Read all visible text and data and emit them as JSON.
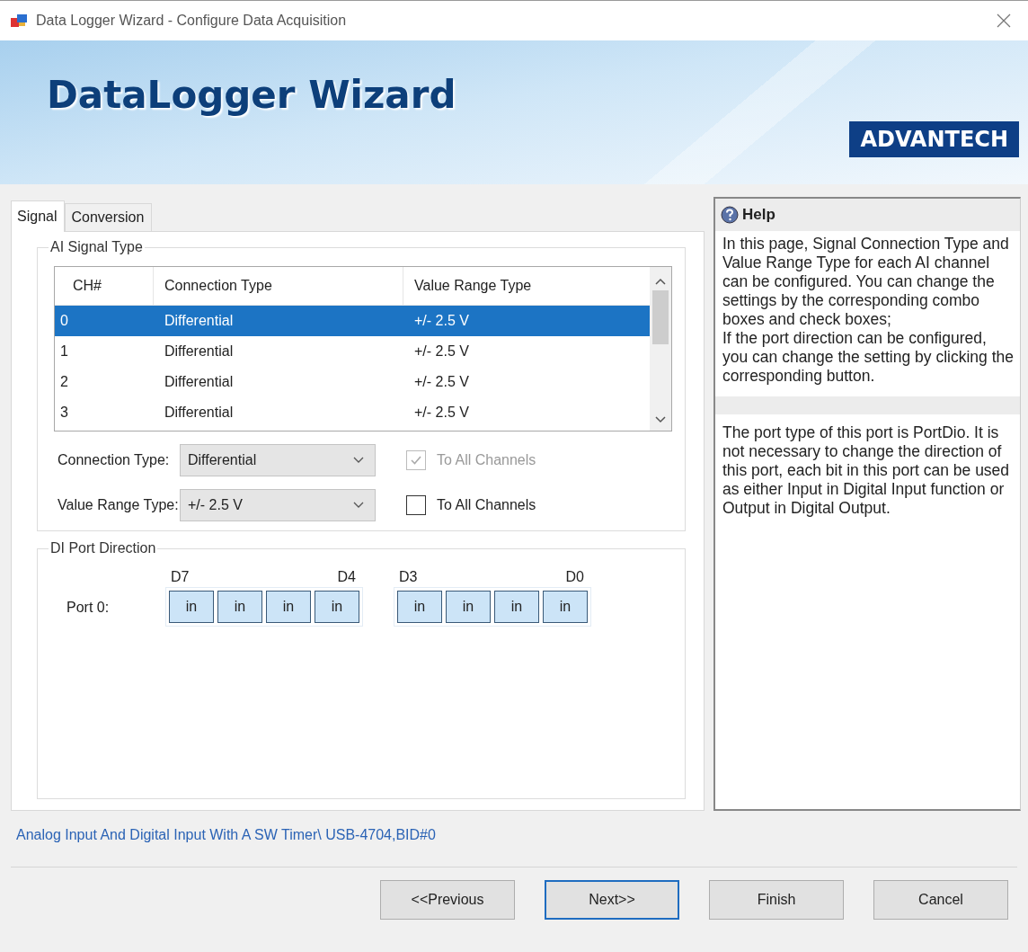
{
  "window": {
    "title": "Data Logger Wizard - Configure Data Acquisition"
  },
  "banner": {
    "title": "DataLogger Wizard",
    "logo": "ADVANTECH"
  },
  "tabs": [
    {
      "label": "Signal",
      "selected": true
    },
    {
      "label": "Conversion",
      "selected": false
    }
  ],
  "ai_signal_type": {
    "title": "AI Signal Type",
    "table": {
      "columns": [
        "CH#",
        "Connection Type",
        "Value Range Type"
      ],
      "rows": [
        {
          "cells": [
            "0",
            "Differential",
            "+/- 2.5 V"
          ],
          "selected": true
        },
        {
          "cells": [
            "1",
            "Differential",
            "+/- 2.5 V"
          ],
          "selected": false
        },
        {
          "cells": [
            "2",
            "Differential",
            "+/- 2.5 V"
          ],
          "selected": false
        },
        {
          "cells": [
            "3",
            "Differential",
            "+/- 2.5 V"
          ],
          "selected": false
        }
      ]
    },
    "settings": [
      {
        "label": "Connection Type:",
        "value": "Differential",
        "checkbox": {
          "label": "To All Channels",
          "checked": true,
          "disabled": true
        }
      },
      {
        "label": "Value Range Type:",
        "value": "+/- 2.5 V",
        "checkbox": {
          "label": "To All Channels",
          "checked": false,
          "disabled": false
        }
      }
    ]
  },
  "di_port_direction": {
    "title": "DI Port Direction",
    "port": {
      "label": "Port 0:",
      "groups": [
        {
          "high": "D7",
          "low": "D4",
          "bits": [
            "in",
            "in",
            "in",
            "in"
          ]
        },
        {
          "high": "D3",
          "low": "D0",
          "bits": [
            "in",
            "in",
            "in",
            "in"
          ]
        }
      ]
    }
  },
  "help": {
    "title": "Help",
    "paragraphs": [
      "In this page, Signal Connection Type and Value Range Type for each AI channel can be configured. You can change the settings by the corresponding combo boxes and check boxes;\nIf the port direction can be configured, you can change the setting by clicking the corresponding button.",
      "The port type of this port is PortDio. It is not necessary to change the direction of this port, each bit in this port can be used as either Input in Digital Input function or Output in Digital Output."
    ]
  },
  "status_text": "Analog Input And Digital Input With A SW Timer\\ USB-4704,BID#0",
  "buttons": [
    {
      "label": "<<Previous",
      "default": false
    },
    {
      "label": "Next>>",
      "default": true
    },
    {
      "label": "Finish",
      "default": false
    },
    {
      "label": "Cancel",
      "default": false
    }
  ]
}
